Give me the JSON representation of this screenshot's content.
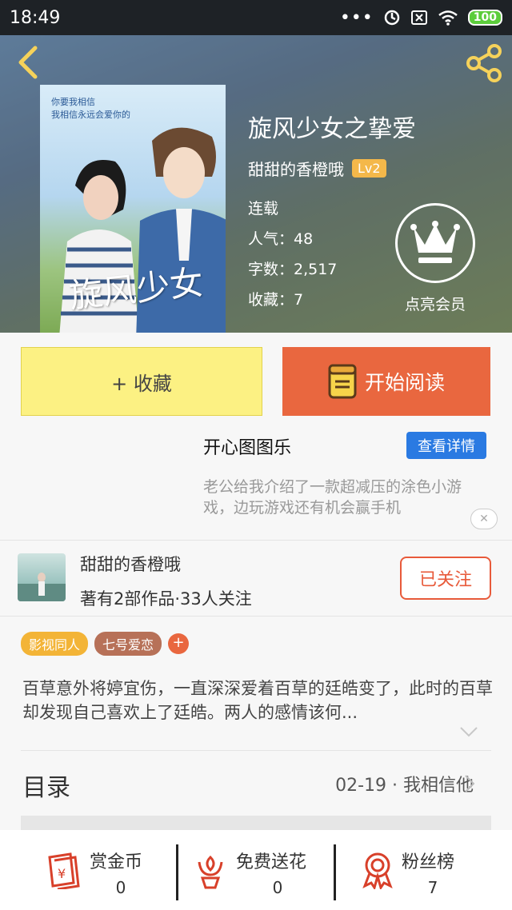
{
  "status_bar": {
    "time": "18:49",
    "dots": "•••",
    "battery": "100"
  },
  "book": {
    "title": "旋风少女之挚爱",
    "author": "甜甜的香橙哦",
    "level": "Lv2",
    "status": "连载",
    "popularity": "人气：48",
    "word_count": "字数：2,517",
    "favorites": "收藏：7",
    "cover_calligraphy": "旋风少女",
    "cover_text_line1": "你要我相信",
    "cover_text_line2": "我相信永远会爱你的"
  },
  "vip": {
    "label": "点亮会员"
  },
  "actions": {
    "collect_label": "+ 收藏",
    "read_label": "开始阅读"
  },
  "ad": {
    "title": "开心图图乐",
    "button": "查看详情",
    "description": "老公给我介绍了一款超减压的涂色小游戏，边玩游戏还有机会赢手机",
    "close": "✕"
  },
  "author_card": {
    "name": "甜甜的香橙哦",
    "stats": "著有2部作品·33人关注",
    "follow_label": "已关注"
  },
  "tags": [
    "影视同人",
    "七号爱恋"
  ],
  "tag_add": "+",
  "synopsis": "百草意外将婷宜伤，一直深深爱着百草的廷皓变了，此时的百草却发现自己喜欢上了廷皓。两人的感情该何...",
  "toc": {
    "label": "目录",
    "latest": "02-19 · 我相信他"
  },
  "bottom_stats": [
    {
      "label": "赏金币",
      "value": "0",
      "icon": "coin-envelope-icon"
    },
    {
      "label": "免费送花",
      "value": "0",
      "icon": "flower-icon"
    },
    {
      "label": "粉丝榜",
      "value": "7",
      "icon": "medal-icon"
    }
  ],
  "colors": {
    "accent_orange": "#e9673f",
    "collect_yellow": "#fcf183",
    "level_badge": "#f4b84a",
    "ad_button_blue": "#2a7ae2",
    "tag_yellow": "#f3b437",
    "tag_brown": "#b77158",
    "icon_red": "#d8402a"
  }
}
